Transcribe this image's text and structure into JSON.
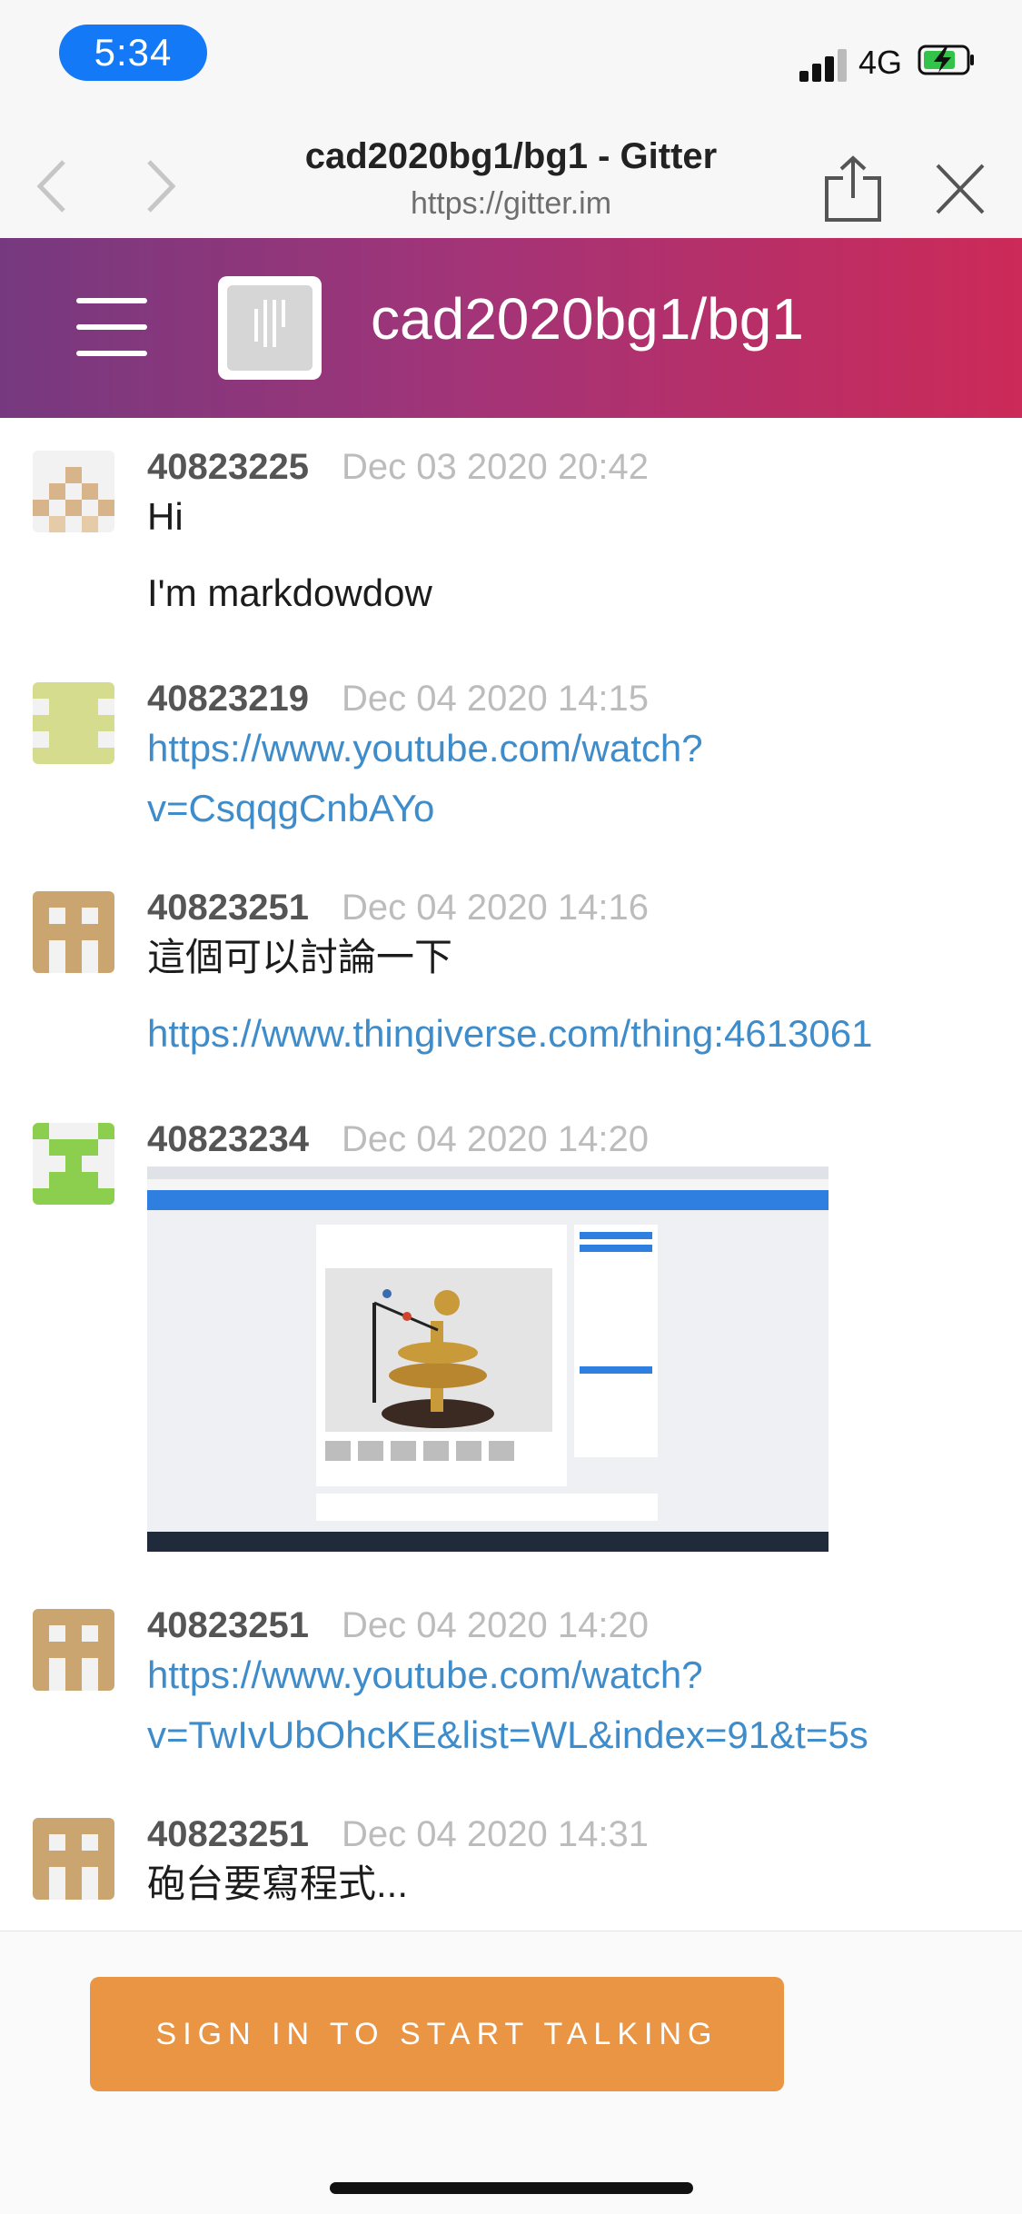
{
  "status_bar": {
    "time": "5:34",
    "network": "4G"
  },
  "browser": {
    "title": "cad2020bg1/bg1 - Gitter",
    "url": "https://gitter.im"
  },
  "room": {
    "name": "cad2020bg1/bg1"
  },
  "messages": [
    {
      "user": "40823225",
      "time": "Dec 03 2020 20:42",
      "lines": [
        "Hi",
        "I'm markdowdow"
      ]
    },
    {
      "user": "40823219",
      "time": "Dec 04 2020 14:15",
      "lines": [
        "https://www.youtube.com/watch?",
        "v=CsqqgCnbAYo"
      ]
    },
    {
      "user": "40823251",
      "time": "Dec 04 2020 14:16",
      "lines": [
        "這個可以討論一下",
        "https://www.thingiverse.com/thing:4613061"
      ]
    },
    {
      "user": "40823234",
      "time": "Dec 04 2020 14:20",
      "lines": []
    },
    {
      "user": "40823251",
      "time": "Dec 04 2020 14:20",
      "lines": [
        "https://www.youtube.com/watch?",
        "v=TwIvUbOhcKE&list=WL&index=91&t=5s"
      ]
    },
    {
      "user": "40823251",
      "time": "Dec 04 2020 14:31",
      "lines": [
        "砲台要寫程式..."
      ]
    }
  ],
  "footer": {
    "signin_label": "SIGN IN TO START TALKING"
  },
  "colors": {
    "header_gradient_start": "#76397f",
    "header_gradient_end": "#cc2a58",
    "link": "#3f8ccb",
    "signin_button": "#e99544",
    "status_pill": "#1479f6"
  }
}
